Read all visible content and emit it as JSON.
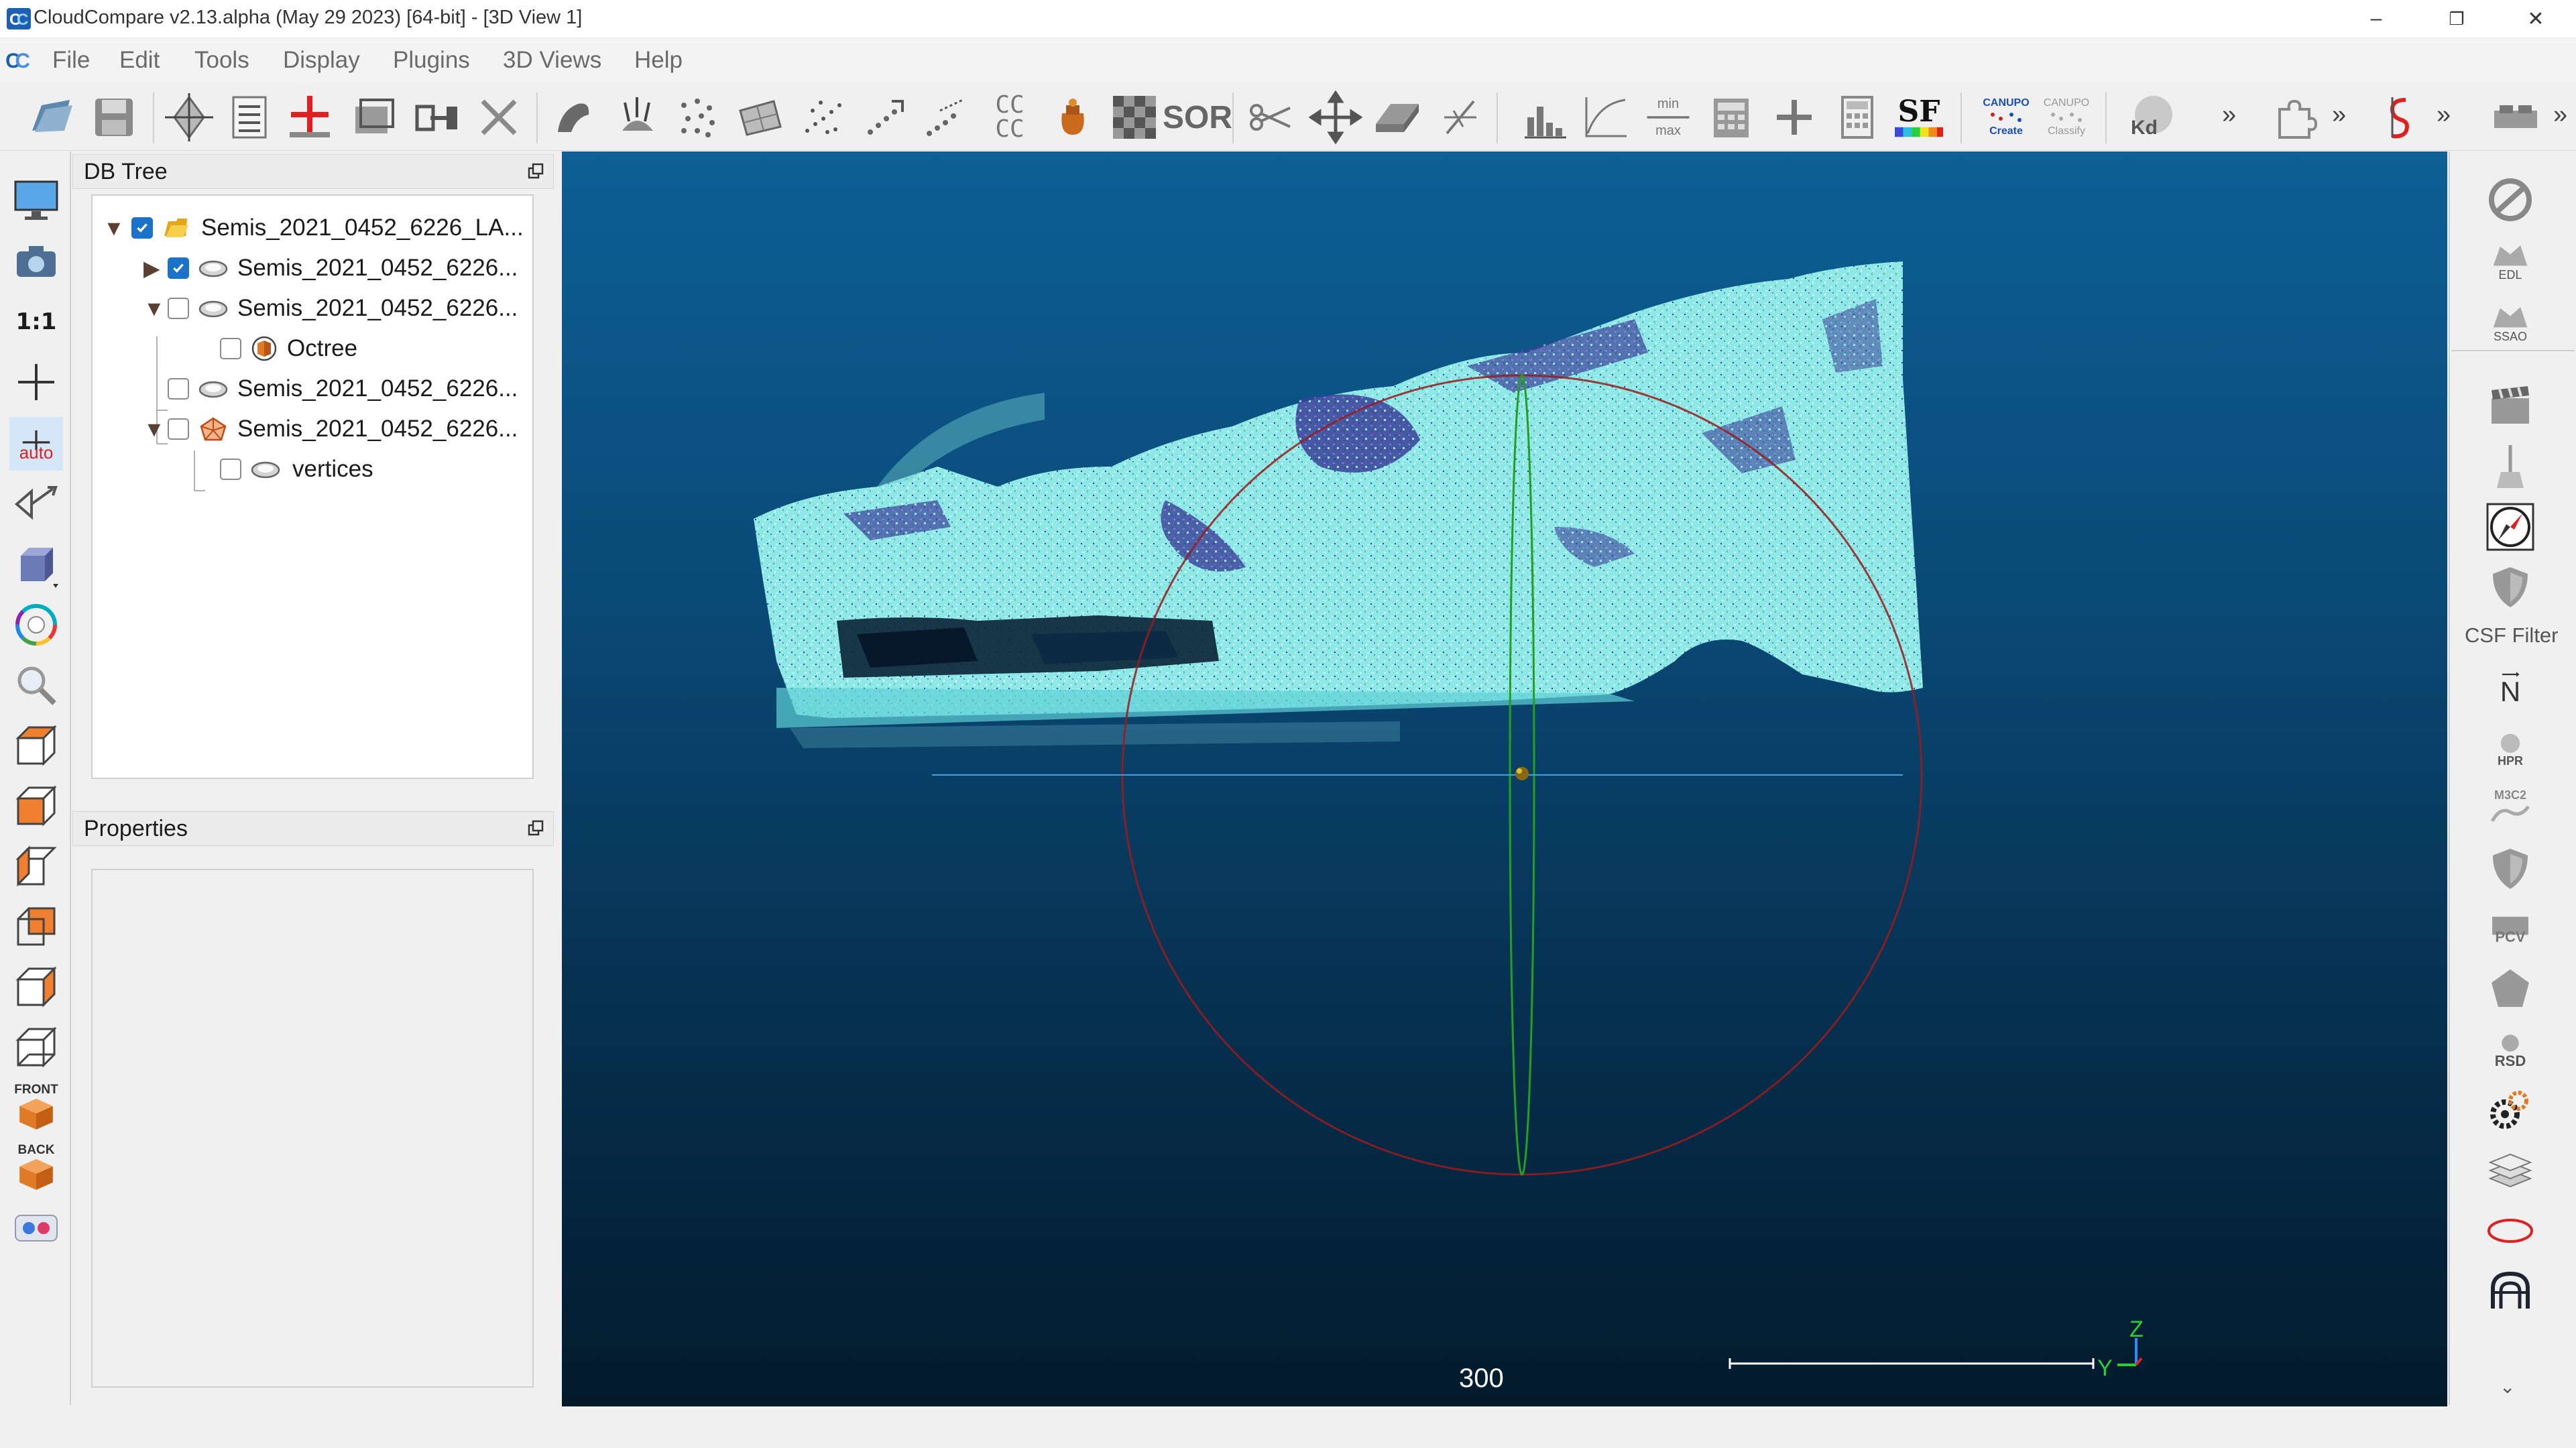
{
  "window": {
    "title": "CloudCompare v2.13.alpha (May 29 2023) [64-bit] - [3D View 1]",
    "minimize": "–",
    "maximize": "❐",
    "close": "✕"
  },
  "menu": [
    "File",
    "Edit",
    "Tools",
    "Display",
    "Plugins",
    "3D Views",
    "Help"
  ],
  "toolbar": {
    "icons": [
      "open-icon",
      "save-icon",
      "point-picking-icon",
      "list-icon",
      "add-point-icon",
      "crop-icon",
      "merge-icon",
      "delete-icon",
      "sample-icon",
      "normals-icon",
      "subsample-icon",
      "mesh-icon",
      "noise-icon",
      "register-icon",
      "distance-icon",
      "cc-text-icon",
      "pot-icon",
      "checker-icon",
      "sor-icon",
      "scissors-icon",
      "translate-icon",
      "plane-icon",
      "section-icon",
      "histogram-icon",
      "curve-icon",
      "min-max-icon",
      "calculator-icon",
      "plus-icon",
      "calc-icon",
      "sf-icon",
      "canupo-create-icon",
      "canupo-classify-icon",
      "kd-icon",
      "puzzle-icon",
      "s-curve-icon",
      "robot-icon"
    ],
    "cc_text": "CC CC",
    "sor_label": "SOR",
    "sf_label": "SF",
    "kd_label": "Kd",
    "minmax_top": "min",
    "minmax_bottom": "max",
    "canupo_create": "Create",
    "canupo_classify": "Classify",
    "canupo_brand": "CANUPO",
    "more": "»"
  },
  "left_toolbar": {
    "one_to_one": "1:1",
    "auto": "auto",
    "front": "FRONT",
    "back": "BACK"
  },
  "db_tree": {
    "title": "DB Tree",
    "items": [
      {
        "label": "Semis_2021_0452_6226_LA...",
        "checked": true,
        "expanded": true,
        "icon": "folder-icon"
      },
      {
        "label": "Semis_2021_0452_6226...",
        "checked": true,
        "expanded": false,
        "icon": "cloud-icon"
      },
      {
        "label": "Semis_2021_0452_6226...",
        "checked": false,
        "expanded": true,
        "icon": "cloud-icon"
      },
      {
        "label": "Octree",
        "checked": false,
        "icon": "octree-icon"
      },
      {
        "label": "Semis_2021_0452_6226...",
        "checked": false,
        "icon": "cloud-icon"
      },
      {
        "label": "Semis_2021_0452_6226...",
        "checked": false,
        "expanded": true,
        "icon": "mesh-icon"
      },
      {
        "label": "vertices",
        "checked": false,
        "icon": "cloud-icon"
      }
    ]
  },
  "properties": {
    "title": "Properties"
  },
  "view3d": {
    "scale_value": "300",
    "axis_z": "Z",
    "axis_y": "Y"
  },
  "right_toolbar": {
    "csf_label": "CSF Filter",
    "north_label": "N",
    "edl": "EDL",
    "ssao": "SSAO",
    "hpr": "HPR",
    "m3c2": "M3C2",
    "pcv": "PCV",
    "rsd": "RSD"
  },
  "colors": {
    "accent": "#1a73c8",
    "view_top": "#0d5f96",
    "view_bottom": "#031a2c",
    "cloud": "#8ee9e6",
    "cloud_dark": "#3b3f9a",
    "sphere": "#a01818"
  }
}
